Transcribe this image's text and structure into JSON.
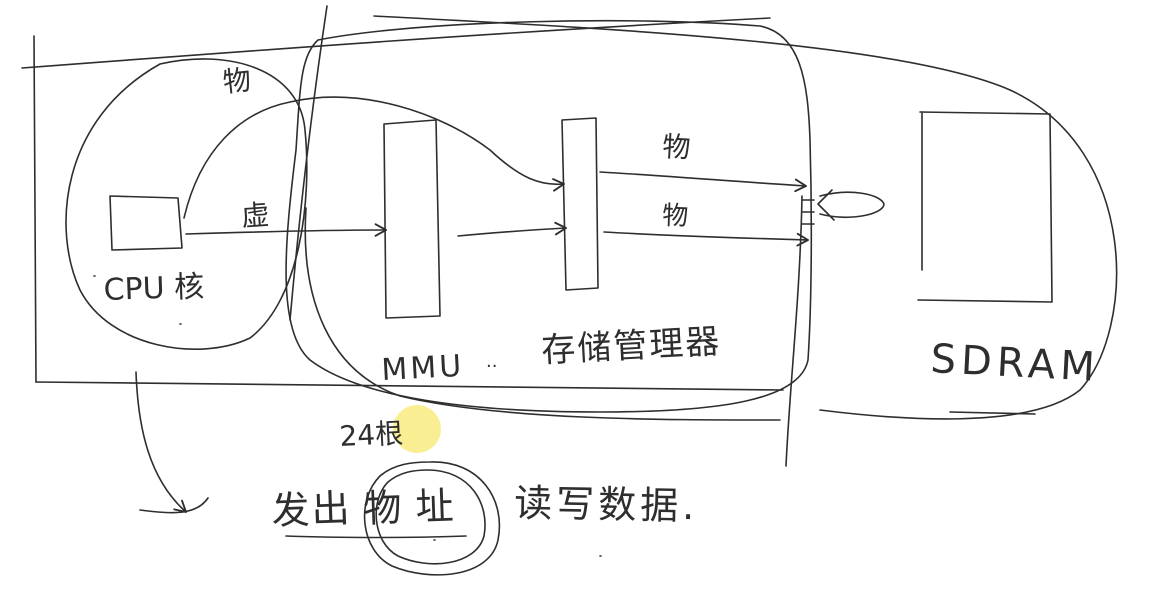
{
  "colors": {
    "paper": "#ffffff",
    "ink": "#2e2e2e",
    "highlight": "#f7e96e"
  },
  "labels": {
    "cpu": "CPU 核",
    "mmu": "MMU",
    "mmu_sep": "··",
    "storage_manager": "存储管理器",
    "sdram": "SDRAM",
    "virtual": "虚",
    "physical": "物",
    "bits": "24根",
    "send": "发出",
    "address": "物址",
    "rw_data": "读写数据."
  }
}
